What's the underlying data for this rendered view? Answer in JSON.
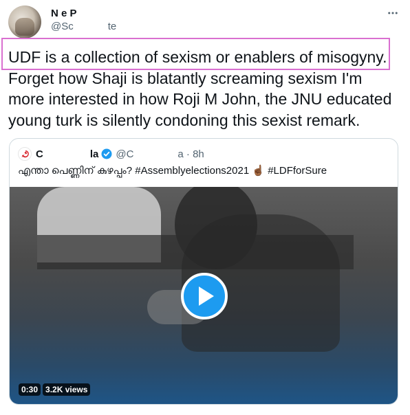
{
  "author": {
    "name": "N e P",
    "handle_start": "@Sc",
    "handle_end": "te"
  },
  "tweet": {
    "lines": [
      "UDF is a collection of sexism or enablers of misogyny.",
      "Forget how Shaji is blatantly screaming sexism I'm",
      "more interested in how Roji M John, the JNU educated",
      "young turk is silently condoning this sexist remark."
    ]
  },
  "quoted": {
    "name_start": "C",
    "name_end": "la",
    "handle": "@C",
    "time": "a · 8h",
    "text_prefix": "എന്താ പെണ്ണിന് കുഴപ്പം? ",
    "hashtag1": "#Assemblyelections2021",
    "emoji": "☝🏾",
    "hashtag2": "#LDFforSure",
    "video_duration": "0:30",
    "video_views": "3.2K views"
  },
  "colors": {
    "highlight": "#d96fd0",
    "accent": "#1d9bf0",
    "party_red": "#d8262e"
  }
}
